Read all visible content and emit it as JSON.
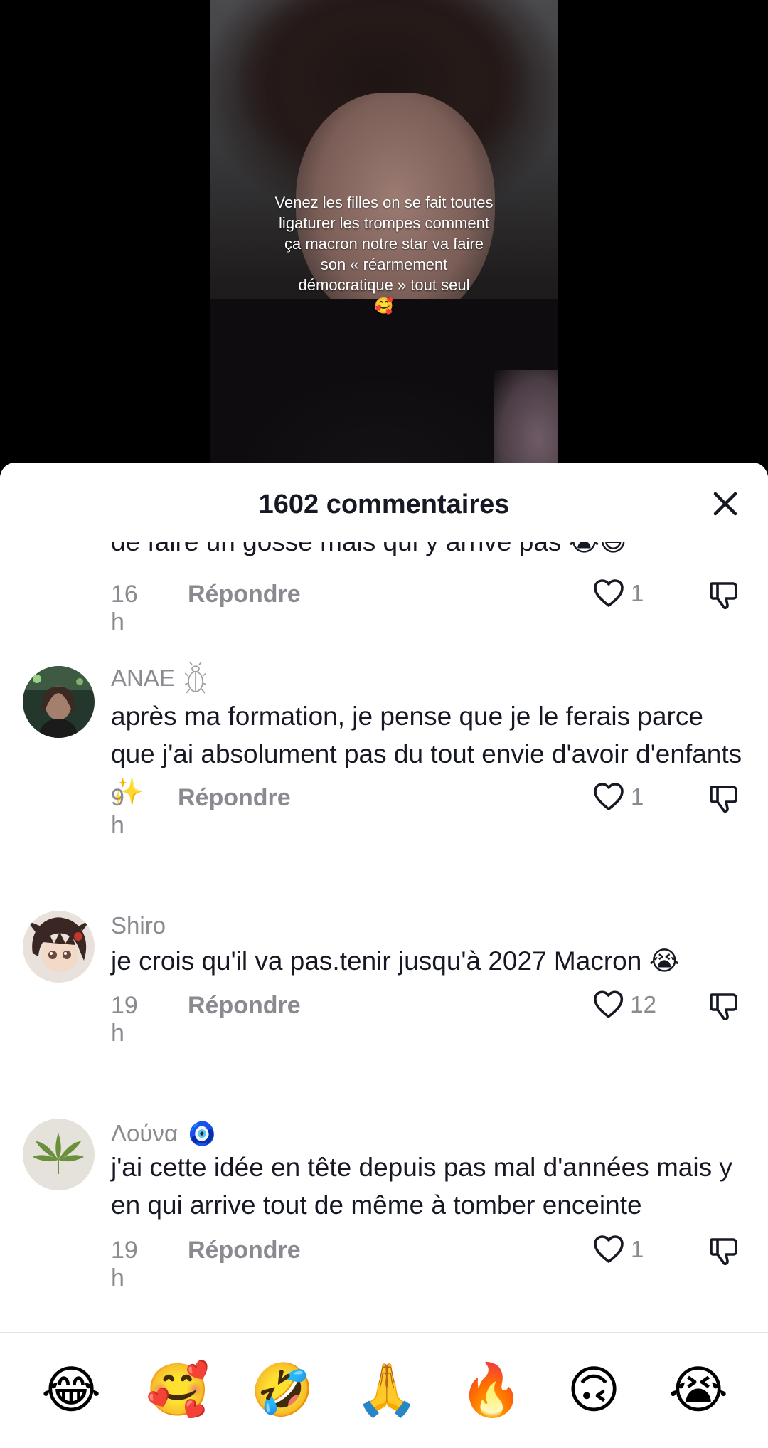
{
  "video": {
    "caption_text": "Venez les filles on se fait toutes ligaturer les trompes comment ça macron notre star va faire son « réarmement démocratique » tout seul",
    "caption_emoji": "🥰"
  },
  "sheet": {
    "title": "1602 commentaires"
  },
  "comments": [
    {
      "cut_text": "de faire un gosse mais qui y arrive pas 😭😅",
      "time": "16 h",
      "reply_label": "Répondre",
      "likes": "1"
    },
    {
      "username": "ANAE",
      "badge": "beetle-icon",
      "text": "après ma formation, je pense que je le ferais parce que j'ai absolument pas du tout envie d'avoir d'enfants ✨",
      "time": "9 h",
      "reply_label": "Répondre",
      "likes": "1"
    },
    {
      "username": "Shiro",
      "text": "je crois qu'il va pas.tenir jusqu'à 2027 Macron 😭",
      "time": "19 h",
      "reply_label": "Répondre",
      "likes": "12"
    },
    {
      "username": "Λούνα",
      "badge_emoji": "🧿",
      "text": "j'ai cette idée en tête depuis pas mal d'années mais y en qui arrive tout de même à tomber enceinte",
      "time": "19 h",
      "reply_label": "Répondre",
      "likes": "1"
    }
  ],
  "emoji_bar": [
    "😂",
    "🥰",
    "🤣",
    "🙏",
    "🔥",
    "🙃",
    "😭"
  ],
  "colors": {
    "text": "#161823",
    "muted": "#8a8b91",
    "sheet": "#ffffff"
  }
}
